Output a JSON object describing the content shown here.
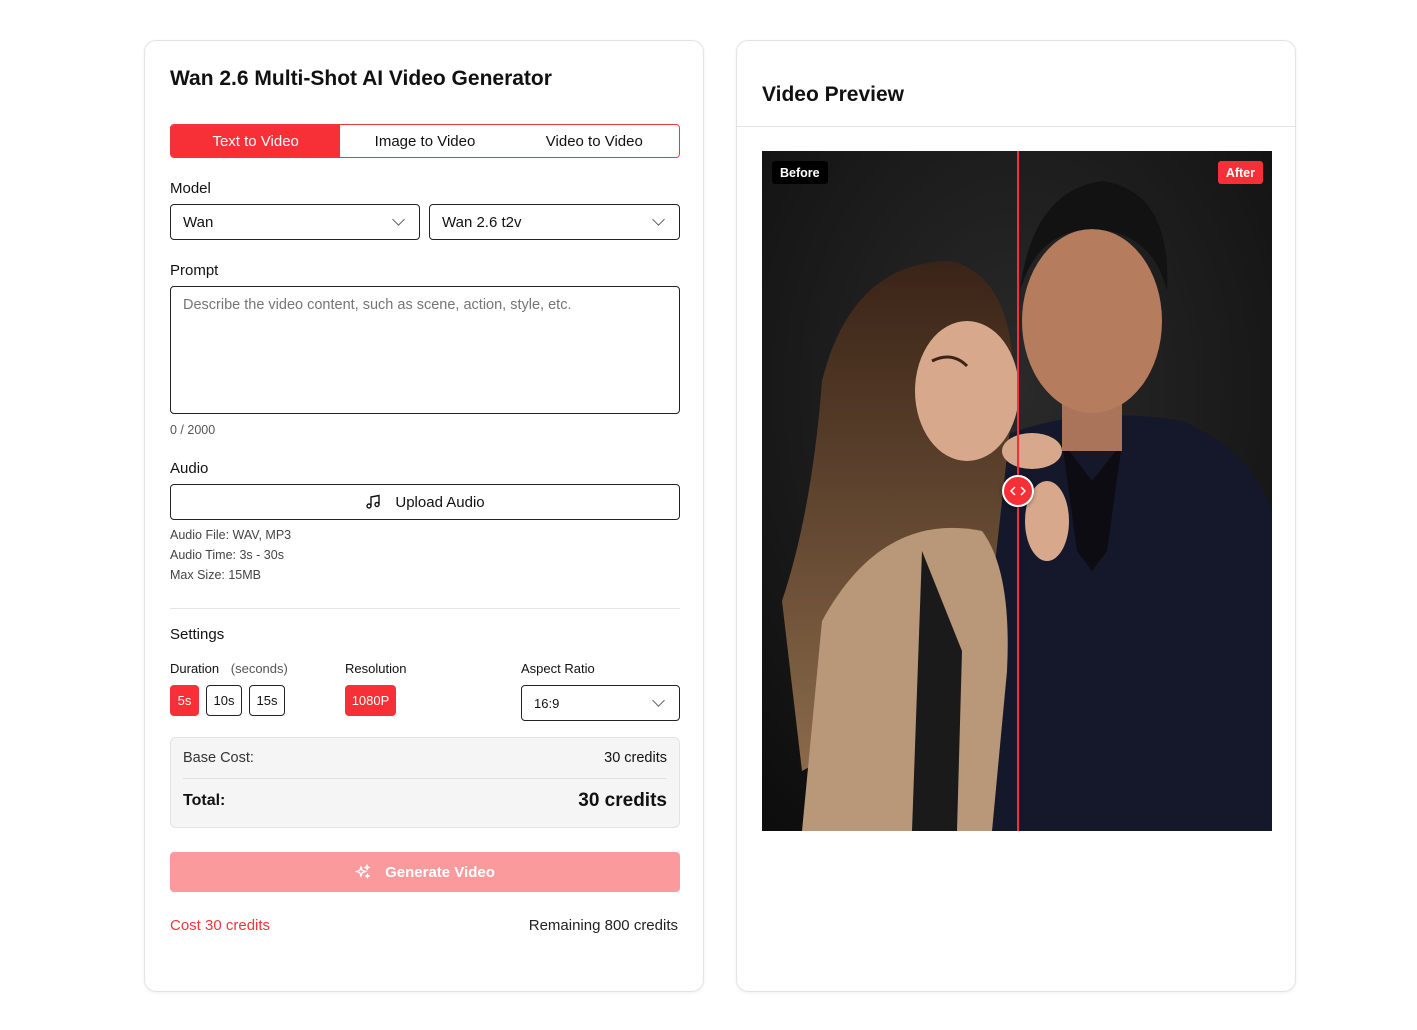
{
  "generator": {
    "title": "Wan 2.6 Multi-Shot AI Video Generator",
    "tabs": [
      {
        "label": "Text to Video",
        "active": true
      },
      {
        "label": "Image to Video",
        "active": false
      },
      {
        "label": "Video to Video",
        "active": false
      }
    ],
    "model_label": "Model",
    "model_family": "Wan",
    "model_version": "Wan 2.6 t2v",
    "prompt_label": "Prompt",
    "prompt_placeholder": "Describe the video content, such as scene, action, style, etc.",
    "prompt_counter": "0 / 2000",
    "audio_label": "Audio",
    "upload_audio_label": "Upload Audio",
    "audio_hints": [
      "Audio File: WAV, MP3",
      "Audio Time: 3s - 30s",
      "Max Size: 15MB"
    ],
    "settings_label": "Settings",
    "duration_label": "Duration",
    "duration_unit": "(seconds)",
    "durations": [
      {
        "label": "5s",
        "selected": true
      },
      {
        "label": "10s",
        "selected": false
      },
      {
        "label": "15s",
        "selected": false
      }
    ],
    "resolution_label": "Resolution",
    "resolution_value": "1080P",
    "aspect_label": "Aspect Ratio",
    "aspect_value": "16:9",
    "base_cost_label": "Base Cost:",
    "base_cost_value": "30 credits",
    "total_label": "Total:",
    "total_value": "30 credits",
    "generate_label": "Generate Video",
    "cost_note": "Cost 30 credits",
    "remaining_note": "Remaining 800 credits"
  },
  "preview": {
    "title": "Video Preview",
    "before_badge": "Before",
    "after_badge": "After",
    "slider_position": 0.5
  },
  "colors": {
    "accent": "#f72f37",
    "accent_disabled": "#fb9a9d",
    "cost_box_bg": "#f5f5f5"
  },
  "icons": {
    "music": "music-note-icon",
    "sparkle": "sparkles-icon",
    "chevron": "chevron-down-icon",
    "compare": "left-right-arrows-icon"
  }
}
